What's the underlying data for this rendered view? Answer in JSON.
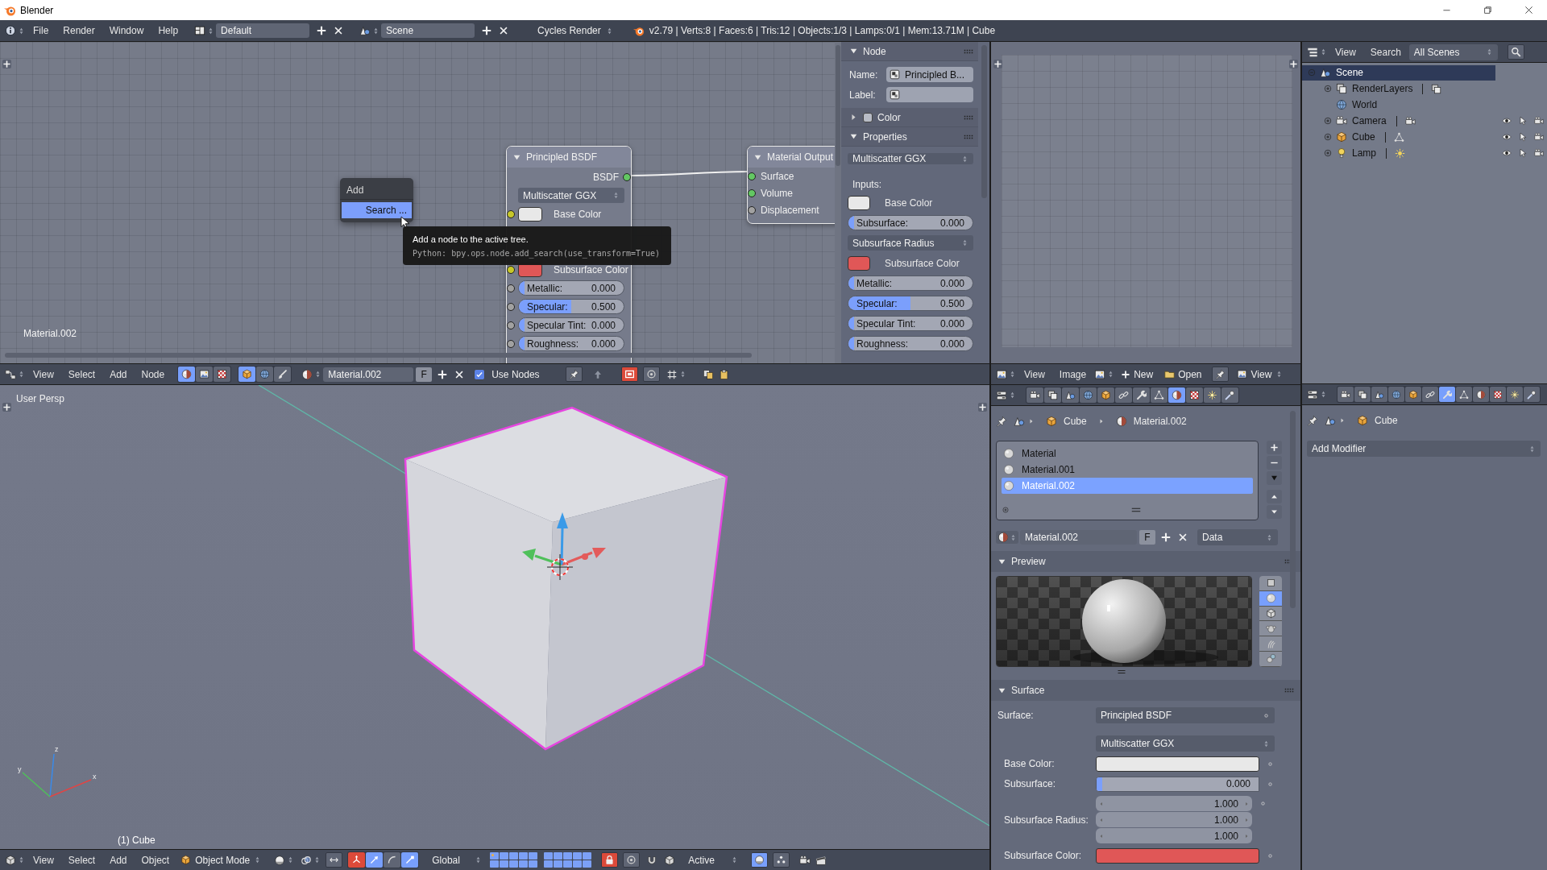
{
  "window": {
    "title": "Blender"
  },
  "info_header": {
    "menus": [
      "File",
      "Render",
      "Window",
      "Help"
    ],
    "layout": "Default",
    "scene": "Scene",
    "render_engine": "Cycles Render",
    "stats": "v2.79 | Verts:8 | Faces:6 | Tris:12 | Objects:1/3 | Lamps:0/1 | Mem:13.71M | Cube"
  },
  "node_editor": {
    "nodes": [
      {
        "kind": "principled",
        "title": "Principled BSDF",
        "outputs": [
          {
            "label": "BSDF",
            "socket": {
              "color": "#63c763"
            },
            "linked": true
          }
        ],
        "distribution": "Multiscatter GGX",
        "inputs": [
          {
            "kind": "color",
            "socket": {
              "color": "#c7c729"
            },
            "label": "Base Color",
            "color": "#e8e8e8"
          },
          {
            "kind": "color",
            "socket": {
              "color": "#c7c729"
            },
            "label": "Subsurface Color",
            "color": "#e05757"
          },
          {
            "kind": "slider",
            "socket": {
              "color": "#a1a1a1"
            },
            "label": "Metallic:",
            "value": "0.000",
            "level": 0
          },
          {
            "kind": "slider",
            "socket": {
              "color": "#a1a1a1"
            },
            "label": "Specular:",
            "value": "0.500",
            "level": 0.5
          },
          {
            "kind": "slider",
            "socket": {
              "color": "#a1a1a1"
            },
            "label": "Specular Tint:",
            "value": "0.000",
            "level": 0
          },
          {
            "kind": "slider",
            "socket": {
              "color": "#a1a1a1"
            },
            "label": "Roughness:",
            "value": "0.000",
            "level": 0
          }
        ]
      },
      {
        "kind": "output",
        "title": "Material Output",
        "inputs": [
          {
            "kind": "socket",
            "socket": {
              "color": "#63c763"
            },
            "label": "Surface",
            "linked": true
          },
          {
            "kind": "socket",
            "socket": {
              "color": "#63c763"
            },
            "label": "Volume"
          },
          {
            "kind": "socket",
            "socket": {
              "color": "#a1a1a1"
            },
            "label": "Displacement"
          }
        ]
      }
    ],
    "tree_name": "Material.002",
    "add_menu": {
      "title": "Add",
      "items": [
        {
          "label": "Search ...",
          "selected": true
        }
      ]
    },
    "tooltip": {
      "description": "Add a node to the active tree.",
      "python": "Python: bpy.ops.node.add_search(use_transform=True)"
    },
    "sidebar": {
      "node_panel": {
        "title": "Node",
        "expanded": true,
        "name_label": "Name:",
        "name": "Principled B...",
        "label_label": "Label:"
      },
      "color_panel": {
        "title": "Color",
        "expanded": false,
        "checked": false
      },
      "properties_panel": {
        "title": "Properties",
        "expanded": true,
        "distribution": "Multiscatter GGX",
        "inputs_label": "Inputs:",
        "inputs": [
          {
            "kind": "color",
            "label": "Base Color",
            "color": "#e8e8e8"
          },
          {
            "kind": "slider",
            "label": "Subsurface:",
            "value": "0.000",
            "level": 0
          },
          {
            "kind": "dropdown",
            "label": "Subsurface Radius"
          },
          {
            "kind": "color",
            "label": "Subsurface Color",
            "color": "#e05757"
          },
          {
            "kind": "slider",
            "label": "Metallic:",
            "value": "0.000",
            "level": 0
          },
          {
            "kind": "slider",
            "label": "Specular:",
            "value": "0.500",
            "level": 0.5
          },
          {
            "kind": "slider",
            "label": "Specular Tint:",
            "value": "0.000",
            "level": 0
          },
          {
            "kind": "slider",
            "label": "Roughness:",
            "value": "0.000",
            "level": 0
          }
        ]
      }
    },
    "header": {
      "menus": [
        "View",
        "Select",
        "Add",
        "Node"
      ],
      "shader_types": [
        {
          "selected": true
        },
        {
          "selected": false
        },
        {
          "selected": false
        }
      ],
      "shader_objects": [
        {
          "selected": true
        },
        {
          "selected": false
        },
        {
          "selected": false
        }
      ],
      "material": "Material.002",
      "fake_user": "F",
      "use_nodes": {
        "label": "Use Nodes",
        "checked": true
      },
      "backdrop": {
        "on": true
      }
    }
  },
  "viewport": {
    "view_name": "User Persp",
    "object_label": "(1) Cube",
    "axes": [
      "z",
      "y",
      "x"
    ],
    "header": {
      "menus": [
        "View",
        "Select",
        "Add",
        "Object"
      ],
      "mode": "Object Mode",
      "manipulator": {
        "on": true
      },
      "manipulator_modes": [
        {
          "selected": true
        },
        {
          "selected": false
        },
        {
          "selected": true
        }
      ],
      "orientation": "Global",
      "layers": [
        {
          "used": true
        },
        {
          "used": false
        },
        {
          "used": false
        },
        {
          "used": false
        },
        {
          "used": false
        },
        {
          "used": false
        },
        {
          "used": false
        },
        {
          "used": false
        },
        {
          "used": false
        },
        {
          "used": false
        },
        {
          "used": false
        },
        {
          "used": false
        },
        {
          "used": false
        },
        {
          "used": false
        },
        {
          "used": false
        },
        {
          "used": false
        },
        {
          "used": false
        },
        {
          "used": false
        },
        {
          "used": false
        },
        {
          "used": false
        }
      ],
      "lock_layers": {
        "on": true
      },
      "snap_target": "Active"
    }
  },
  "image_editor": {
    "header": {
      "menus": [
        "View",
        "Image"
      ],
      "new": "New",
      "open": "Open",
      "view": "View"
    }
  },
  "outliner": {
    "header": {
      "menus": [
        "View",
        "Search"
      ],
      "display": "All Scenes"
    },
    "tree": [
      {
        "label": "Scene",
        "kind": "scene",
        "expanded": true,
        "selected": true,
        "children": [
          {
            "label": "RenderLayers",
            "kind": "renderlayers",
            "expanded": false,
            "selected": false
          },
          {
            "label": "World",
            "kind": "world",
            "selected": false
          },
          {
            "label": "Camera",
            "kind": "camera",
            "expanded": false,
            "selected": false,
            "visible": true,
            "selectable": true,
            "renderable": true
          },
          {
            "label": "Cube",
            "kind": "mesh",
            "expanded": false,
            "selected": false,
            "visible": true,
            "selectable": true,
            "renderable": true
          },
          {
            "label": "Lamp",
            "kind": "lamp",
            "expanded": false,
            "selected": false,
            "visible": true,
            "selectable": true,
            "renderable": true
          }
        ]
      }
    ]
  },
  "material_properties": {
    "tabs": [
      {
        "selected": false
      },
      {
        "selected": false
      },
      {
        "selected": false
      },
      {
        "selected": false
      },
      {
        "selected": false
      },
      {
        "selected": false
      },
      {
        "selected": false
      },
      {
        "selected": false
      },
      {
        "selected": true
      },
      {
        "selected": false
      },
      {
        "selected": false
      },
      {
        "selected": false
      }
    ],
    "breadcrumb": [
      "Cube",
      "Material.002"
    ],
    "slots": [
      {
        "label": "Material",
        "selected": false
      },
      {
        "label": "Material.001",
        "selected": false
      },
      {
        "label": "Material.002",
        "selected": true
      }
    ],
    "material": "Material.002",
    "fake_user": "F",
    "link": "Data",
    "preview": {
      "title": "Preview",
      "expanded": true,
      "shapes": [
        {
          "selected": false
        },
        {
          "selected": true
        },
        {
          "selected": false
        },
        {
          "selected": false
        },
        {
          "selected": false
        },
        {
          "selected": false
        }
      ]
    },
    "surface": {
      "title": "Surface",
      "expanded": true,
      "rows": [
        {
          "kind": "shader",
          "label": "Surface:",
          "value": "Principled BSDF"
        },
        {
          "kind": "dropdown",
          "value": "Multiscatter GGX"
        },
        {
          "kind": "color",
          "label": "Base Color:",
          "color": "#e8e8e8"
        },
        {
          "kind": "slider",
          "label": "Subsurface:",
          "value": "0.000",
          "level": 0
        },
        {
          "kind": "vector",
          "label": "Subsurface Radius:",
          "values": [
            "1.000",
            "1.000",
            "1.000"
          ]
        },
        {
          "kind": "color",
          "label": "Subsurface Color:",
          "color": "#e05757"
        }
      ]
    }
  },
  "modifier_properties": {
    "tabs": [
      {
        "selected": false
      },
      {
        "selected": false
      },
      {
        "selected": false
      },
      {
        "selected": false
      },
      {
        "selected": false
      },
      {
        "selected": false
      },
      {
        "selected": true
      },
      {
        "selected": false
      },
      {
        "selected": false
      },
      {
        "selected": false
      },
      {
        "selected": false
      },
      {
        "selected": false
      }
    ],
    "breadcrumb": [
      "Cube"
    ],
    "add_modifier": "Add Modifier"
  }
}
